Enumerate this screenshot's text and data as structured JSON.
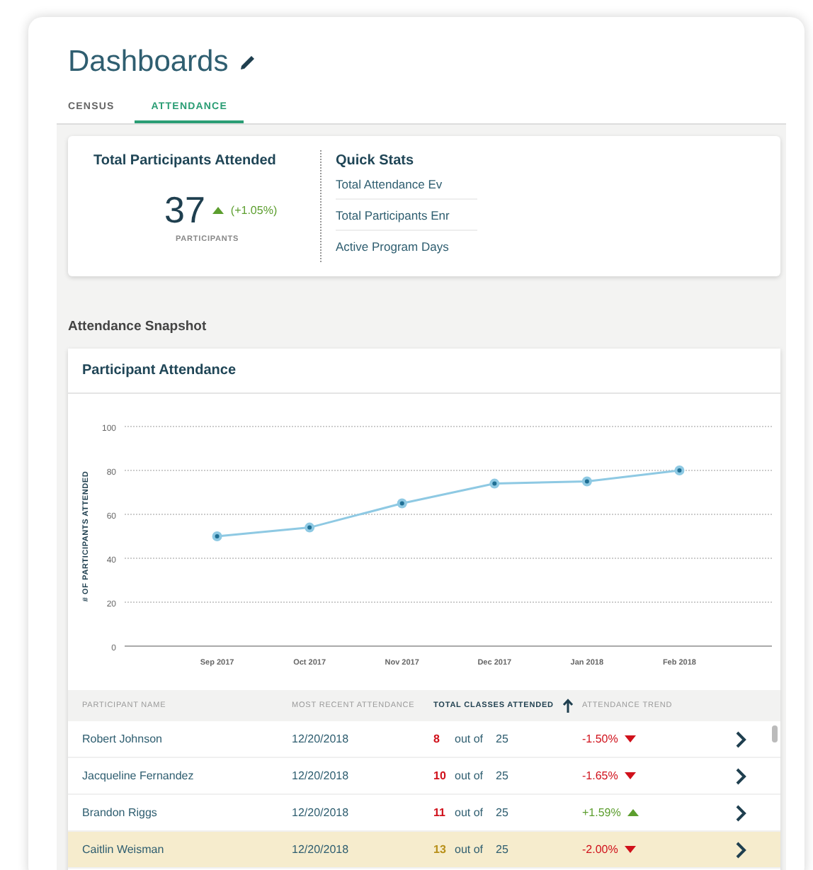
{
  "page": {
    "title": "Dashboards"
  },
  "tabs": [
    {
      "label": "CENSUS",
      "selected": false
    },
    {
      "label": "ATTENDANCE",
      "selected": true
    }
  ],
  "summary": {
    "title": "Total Participants Attended",
    "value": "37",
    "rising": true,
    "change": "(+1.05%)",
    "unit": "PARTICIPANTS"
  },
  "quick_stats": {
    "title": "Quick Stats",
    "items": [
      "Total Attendance Ev",
      "Total Participants Enr",
      "Active Program Days"
    ]
  },
  "section_title": "Attendance Snapshot",
  "chart_card": {
    "title": "Participant Attendance",
    "chart_data": {
      "type": "line",
      "ylabel": "# OF PARTICIPANTS ATTENDED",
      "categories": [
        "Sep 2017",
        "Oct 2017",
        "Nov 2017",
        "Dec 2017",
        "Jan 2018",
        "Feb  2018"
      ],
      "series": [
        {
          "color": "#8ec9e3",
          "marker": "circle",
          "values": [
            50,
            54,
            65,
            74,
            75,
            80
          ]
        }
      ],
      "grid": true,
      "ylim": [
        0,
        100
      ],
      "yticks": [
        0,
        20,
        40,
        60,
        80,
        100
      ]
    }
  },
  "table": {
    "columns": [
      {
        "label": "PARTICIPANT NAME",
        "sorted": false
      },
      {
        "label": "MOST RECENT ATTENDANCE",
        "sorted": false
      },
      {
        "label": "TOTAL CLASSES ATTENDED",
        "sorted": true
      },
      {
        "label": "ATTENDANCE TREND",
        "sorted": false
      }
    ],
    "rows": [
      {
        "name": "Robert Johnson",
        "date": "12/20/2018",
        "count": "8",
        "color": "#d0111b",
        "of": "out of",
        "total": "25",
        "rising": false,
        "change": "-1.50%",
        "selected": false
      },
      {
        "name": "Jacqueline Fernandez",
        "date": "12/20/2018",
        "count": "10",
        "color": "#d0111b",
        "of": "out of",
        "total": "25",
        "rising": false,
        "change": "-1.65%",
        "selected": false
      },
      {
        "name": "Brandon Riggs",
        "date": "12/20/2018",
        "count": "11",
        "color": "#d0111b",
        "of": "out of",
        "total": "25",
        "rising": true,
        "change": "+1.59%",
        "selected": false
      },
      {
        "name": "Caitlin Weisman",
        "date": "12/20/2018",
        "count": "13",
        "color": "#b8901a",
        "of": "out of",
        "total": "25",
        "rising": false,
        "change": "-2.00%",
        "selected": true
      }
    ]
  }
}
